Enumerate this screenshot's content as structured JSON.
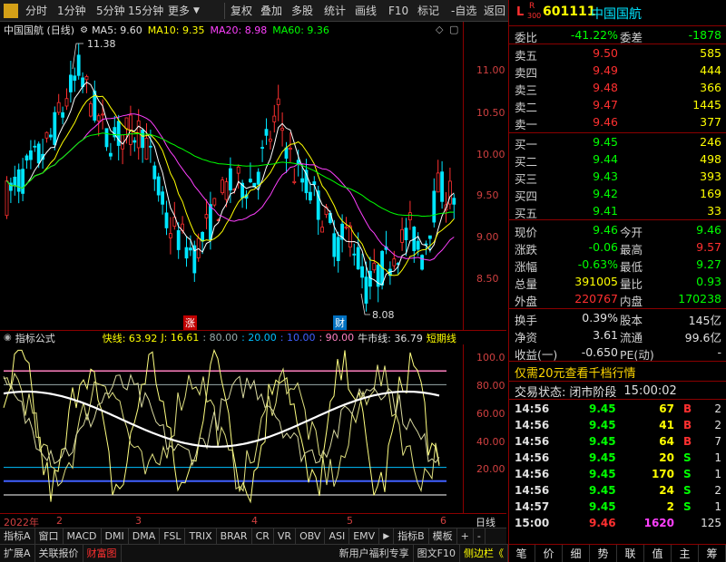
{
  "toolbar": {
    "items": [
      "分时",
      "1分钟",
      "5分钟",
      "15分钟",
      "更多",
      "复权",
      "叠加",
      "多股",
      "统计",
      "画线",
      "F10",
      "标记",
      "-自选",
      "返回"
    ]
  },
  "stock": {
    "market_badge_top": "L",
    "market_badge_r": "R",
    "market_badge_num": "300",
    "code": "601111",
    "name": "中国国航"
  },
  "chart": {
    "title": "中国国航 (日线)",
    "ma5": "MA5: 9.60",
    "ma10": "MA10: 9.35",
    "ma20": "MA20: 8.98",
    "ma60": "MA60: 9.36",
    "high_label": "11.38",
    "low_label": "8.08",
    "marker_zhang": "涨",
    "marker_cai": "财",
    "price_ticks": [
      "11.00",
      "10.50",
      "10.00",
      "9.50",
      "9.00",
      "8.50"
    ],
    "colors": {
      "up": "#ff3030",
      "down": "#00e5ff",
      "ma5": "#ffffff",
      "ma10": "#ffff00",
      "ma20": "#ff40ff",
      "ma60": "#00ff00"
    }
  },
  "indicator": {
    "label": "指标公式",
    "kuai": "快线: 63.92",
    "j": "J: 16.61",
    "l80": ": 80.00",
    "l20": ": 20.00",
    "l10": ": 10.00",
    "l90": ": 90.00",
    "niu": "牛市线: 36.79",
    "duan": "短期线",
    "ticks": [
      "100.0",
      "80.00",
      "60.00",
      "40.00",
      "20.00"
    ]
  },
  "dates": [
    "2022年",
    "2",
    "3",
    "4",
    "5",
    "6"
  ],
  "period": "日线",
  "indicator_tabs": [
    "指标A",
    "窗口",
    "MACD",
    "DMI",
    "DMA",
    "FSL",
    "TRIX",
    "BRAR",
    "CR",
    "VR",
    "OBV",
    "ASI",
    "EMV",
    "指标B",
    "模板",
    "+",
    "-"
  ],
  "status_tabs": [
    "扩展A",
    "关联报价",
    "财富图"
  ],
  "status_right": [
    "新用户福利专享",
    "图文F10",
    "侧边栏《"
  ],
  "quote": {
    "weibi_label": "委比",
    "weibi": "-41.22%",
    "weicha_label": "委差",
    "weicha": "-1878",
    "asks": [
      {
        "label": "卖五",
        "price": "9.50",
        "vol": "585"
      },
      {
        "label": "卖四",
        "price": "9.49",
        "vol": "444"
      },
      {
        "label": "卖三",
        "price": "9.48",
        "vol": "366"
      },
      {
        "label": "卖二",
        "price": "9.47",
        "vol": "1445"
      },
      {
        "label": "卖一",
        "price": "9.46",
        "vol": "377"
      }
    ],
    "bids": [
      {
        "label": "买一",
        "price": "9.45",
        "vol": "246"
      },
      {
        "label": "买二",
        "price": "9.44",
        "vol": "498"
      },
      {
        "label": "买三",
        "price": "9.43",
        "vol": "393"
      },
      {
        "label": "买四",
        "price": "9.42",
        "vol": "169"
      },
      {
        "label": "买五",
        "price": "9.41",
        "vol": "33"
      }
    ],
    "stats": [
      {
        "l1": "现价",
        "v1": "9.46",
        "l2": "今开",
        "v2": "9.46"
      },
      {
        "l1": "涨跌",
        "v1": "-0.06",
        "l2": "最高",
        "v2": "9.57"
      },
      {
        "l1": "涨幅",
        "v1": "-0.63%",
        "l2": "最低",
        "v2": "9.27"
      },
      {
        "l1": "总量",
        "v1": "391005",
        "l2": "量比",
        "v2": "0.93"
      },
      {
        "l1": "外盘",
        "v1": "220767",
        "l2": "内盘",
        "v2": "170238"
      }
    ],
    "fund": [
      {
        "l1": "换手",
        "v1": "0.39%",
        "l2": "股本",
        "v2": "145亿"
      },
      {
        "l1": "净资",
        "v1": "3.61",
        "l2": "流通",
        "v2": "99.6亿"
      },
      {
        "l1": "收益(一)",
        "v1": "-0.650",
        "l2": "PE(动)",
        "v2": "-"
      }
    ],
    "promo": "仅需20元查看千档行情",
    "trade_status_label": "交易状态:",
    "trade_status": "闭市阶段",
    "trade_time": "15:00:02",
    "ticks": [
      {
        "t": "14:56",
        "p": "9.45",
        "v": "67",
        "s": "B",
        "n": "2"
      },
      {
        "t": "14:56",
        "p": "9.45",
        "v": "41",
        "s": "B",
        "n": "2"
      },
      {
        "t": "14:56",
        "p": "9.45",
        "v": "64",
        "s": "B",
        "n": "7"
      },
      {
        "t": "14:56",
        "p": "9.45",
        "v": "20",
        "s": "S",
        "n": "1"
      },
      {
        "t": "14:56",
        "p": "9.45",
        "v": "170",
        "s": "S",
        "n": "1"
      },
      {
        "t": "14:56",
        "p": "9.45",
        "v": "24",
        "s": "S",
        "n": "2"
      },
      {
        "t": "14:57",
        "p": "9.45",
        "v": "2",
        "s": "S",
        "n": "1"
      },
      {
        "t": "15:00",
        "p": "9.46",
        "v": "1620",
        "s": "",
        "n": "125"
      }
    ]
  },
  "bottom_tools": [
    "笔",
    "价",
    "细",
    "势",
    "联",
    "值",
    "主",
    "筹"
  ]
}
